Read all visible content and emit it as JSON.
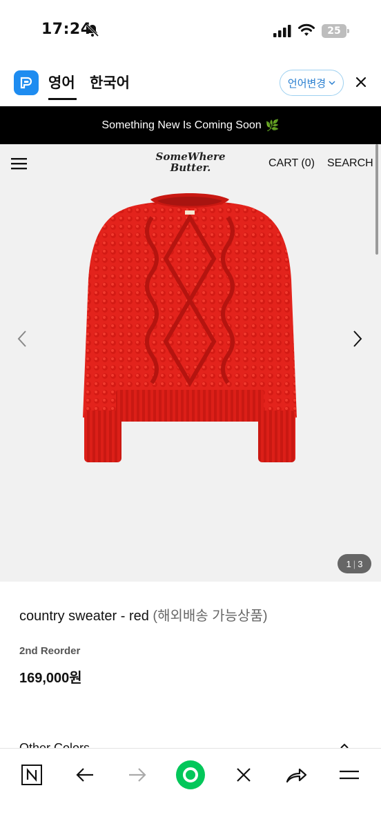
{
  "status_bar": {
    "time": "17:24",
    "battery": "25",
    "icons": [
      "bell-slash-icon",
      "signal-icon",
      "wifi-icon",
      "battery-icon"
    ]
  },
  "translate_bar": {
    "tabs": [
      "영어",
      "한국어"
    ],
    "active_tab": "영어",
    "change_button": "언어변경",
    "accent": "#1e8cf0"
  },
  "announcement": {
    "text": "Something New Is Coming Soon",
    "emoji": "🌿"
  },
  "header": {
    "logo_line1": "SomeWhere",
    "logo_line2": "Butter.",
    "cart": "CART (0)",
    "search": "SEARCH"
  },
  "gallery": {
    "current": "1",
    "total": "3",
    "separator": "|",
    "image_color": "#e0261f"
  },
  "product": {
    "name": "country sweater - red",
    "note": "(해외배송 가능상품)",
    "badge": "2nd Reorder",
    "price": "169,000원",
    "other_colors_label": "Other Colors"
  },
  "toolbar": {
    "icons": [
      "naver-n-icon",
      "back-arrow-icon",
      "forward-arrow-icon",
      "green-home-icon",
      "close-icon",
      "share-icon",
      "menu-icon"
    ],
    "accent": "#03c75a"
  }
}
